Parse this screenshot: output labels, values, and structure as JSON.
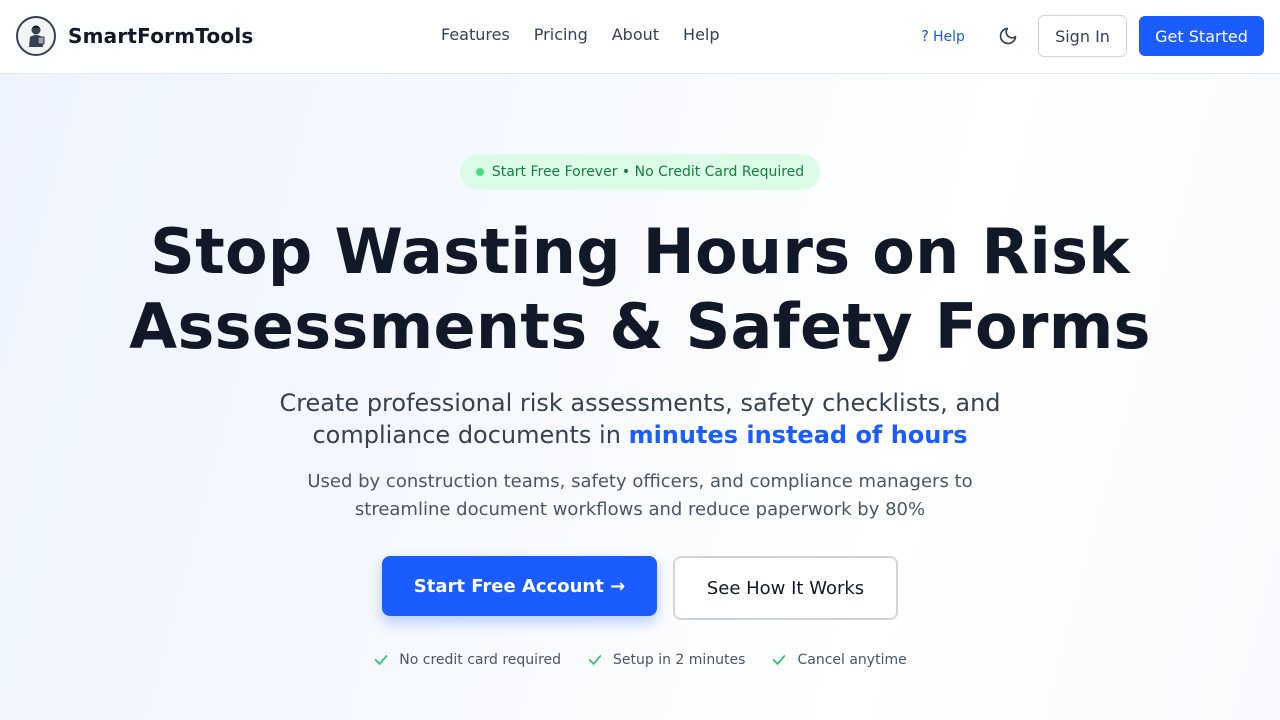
{
  "header": {
    "brand": "SmartFormTools",
    "nav": [
      "Features",
      "Pricing",
      "About",
      "Help"
    ],
    "help_link": "Help",
    "sign_in": "Sign In",
    "get_started": "Get Started"
  },
  "hero": {
    "badge": "Start Free Forever • No Credit Card Required",
    "headline_line1": "Stop Wasting Hours on Risk",
    "headline_line2": "Assessments & Safety Forms",
    "subhead_line1": "Create professional risk assessments, safety checklists, and",
    "subhead_line2_prefix": "compliance documents in ",
    "subhead_accent": "minutes instead of hours",
    "desc_line1": "Used by construction teams, safety officers, and compliance managers to",
    "desc_line2": "streamline document workflows and reduce paperwork by 80%",
    "cta_primary": "Start Free Account →",
    "cta_secondary": "See How It Works",
    "features": [
      "No credit card required",
      "Setup in 2 minutes",
      "Cancel anytime"
    ]
  },
  "colors": {
    "accent": "#1a5cff",
    "badge_bg": "#dcfce7",
    "badge_text": "#15803d",
    "check": "#22c55e"
  },
  "icons": {
    "logo": "worker-logo-icon",
    "help": "question-mark-icon",
    "theme": "moon-icon",
    "feature": "check-icon"
  }
}
